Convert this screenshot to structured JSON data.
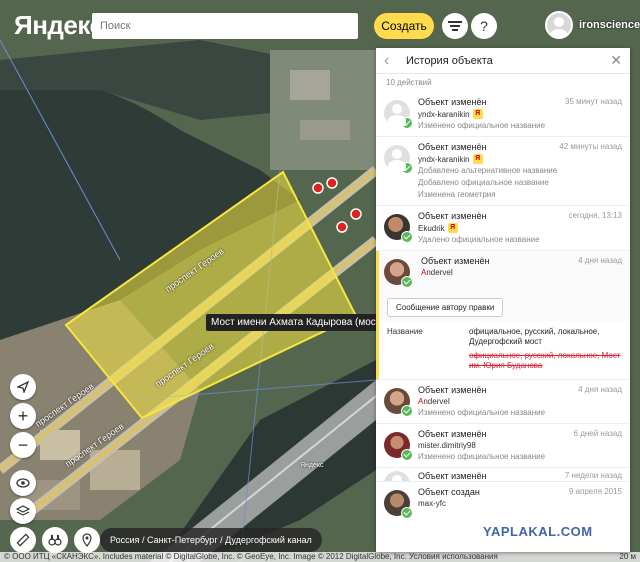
{
  "header": {
    "logo": "Яндекс",
    "search_placeholder": "Поиск",
    "create_label": "Создать",
    "help_label": "?",
    "username": "ironscience"
  },
  "map": {
    "tooltip": "Мост имени Ахмата Кадырова (мост)",
    "street_labels": [
      "проспект Героев",
      "проспект Героев",
      "проспект Героев",
      "проспект Героев"
    ],
    "highway_label": "Яндекс",
    "breadcrumb": "Россия / Санкт-Петербург / Дудергофский канал",
    "copyright": "© ООО ИТЦ «СКАНЭКС». Includes material © DigitalGlobe, Inc. © GeoEye, Inc. Image © 2012 DigitalGlobe, Inc. Условия использования",
    "scale": "20 м",
    "highlight_color": "#f5e642"
  },
  "panel": {
    "title": "История объекта",
    "count": "10 действий",
    "message_button": "Сообщение автору правки",
    "diff": {
      "label": "Название",
      "new_value": "официальное, русский, локальное, Дудергофский мост",
      "old_value": "официальное, русский, локальное, Мост им. Юрия Буданова"
    },
    "entries": [
      {
        "action": "Объект изменён",
        "time": "35 минут назад",
        "user": "yndx-karanikin",
        "first": "",
        "ya": true,
        "avatar": "gray",
        "desc": [
          "Изменено официальное название"
        ]
      },
      {
        "action": "Объект изменён",
        "time": "42 минуты назад",
        "user": "yndx-karanikin",
        "first": "",
        "ya": true,
        "avatar": "gray",
        "desc": [
          "Добавлено альтернативное название",
          "Добавлено официальное название",
          "Изменена геометрия"
        ]
      },
      {
        "action": "Объект изменён",
        "time": "сегодня, 13:13",
        "user": "Ekudrik",
        "first": "",
        "ya": true,
        "avatar": "photo1",
        "desc": [
          "Удалено официальное название"
        ]
      },
      {
        "action": "Объект изменён",
        "time": "4 дня назад",
        "user_first": "A",
        "user_rest": "nderveI",
        "ya": false,
        "avatar": "photo2",
        "desc": []
      },
      {
        "action": "Объект изменён",
        "time": "4 дня назад",
        "user_first": "A",
        "user_rest": "nderveI",
        "ya": false,
        "avatar": "photo2",
        "desc": [
          "Изменено официальное название"
        ]
      },
      {
        "action": "Объект изменён",
        "time": "6 дней назад",
        "user": "mister.dimitriy98",
        "ya": false,
        "avatar": "photo3",
        "desc": [
          "Изменено официальное название"
        ]
      },
      {
        "action": "Объект изменён",
        "time": "7 недели назад",
        "user": "",
        "ya": false,
        "avatar": "gray",
        "desc": []
      },
      {
        "action": "Объект создан",
        "time": "9 апреля 2015",
        "user": "max-yfc",
        "ya": false,
        "avatar": "photo4",
        "desc": []
      }
    ]
  },
  "watermark": "YAPLAKAL.COM"
}
